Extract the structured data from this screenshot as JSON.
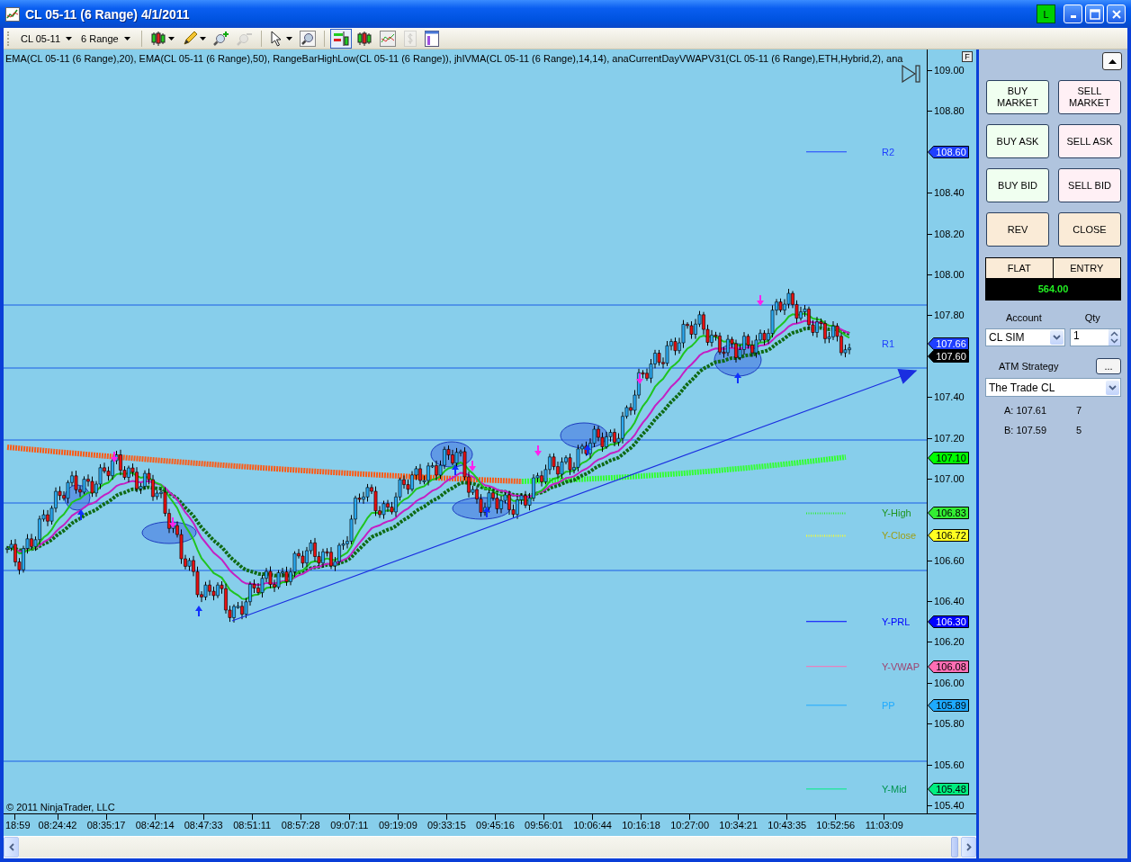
{
  "window": {
    "title": "CL 05-11 (6 Range)  4/1/2011",
    "badge": "L"
  },
  "toolbar": {
    "instrument": "CL 05-11",
    "period": "6 Range",
    "tool_groups": [
      [
        {
          "kind": "chart_style",
          "selected": false,
          "disabled": false
        },
        {
          "kind": "drawing",
          "selected": false,
          "disabled": false
        },
        {
          "kind": "zoom_in",
          "selected": false,
          "disabled": false
        },
        {
          "kind": "zoom_out",
          "selected": false,
          "disabled": true
        }
      ],
      [
        {
          "kind": "cursor",
          "selected": false,
          "disabled": false
        },
        {
          "kind": "magnifier",
          "selected": false,
          "disabled": false
        }
      ],
      [
        {
          "kind": "chart_trader",
          "selected": true,
          "disabled": false
        },
        {
          "kind": "data_series",
          "selected": false,
          "disabled": false
        },
        {
          "kind": "indicators",
          "selected": false,
          "disabled": false
        },
        {
          "kind": "strategies",
          "selected": false,
          "disabled": true
        },
        {
          "kind": "properties",
          "selected": false,
          "disabled": false
        }
      ]
    ]
  },
  "chart": {
    "legend": "EMA(CL 05-11 (6 Range),20), EMA(CL 05-11 (6 Range),50), RangeBarHighLow(CL 05-11 (6 Range)), jhIVMA(CL 05-11 (6 Range),14,14), anaCurrentDayVWAPV31(CL 05-11 (6 Range),ETH,Hybrid,2), ana",
    "corner_button": "F",
    "copyright": "© 2011 NinjaTrader, LLC",
    "price_ticks": [
      "109.00",
      "108.80",
      "108.40",
      "108.20",
      "108.00",
      "107.80",
      "107.40",
      "107.20",
      "107.00",
      "106.60",
      "106.40",
      "106.20",
      "106.00",
      "105.80",
      "105.60",
      "105.40"
    ],
    "time_labels": [
      "18:59",
      "08:24:42",
      "08:35:17",
      "08:42:14",
      "08:47:33",
      "08:51:11",
      "08:57:28",
      "09:07:11",
      "09:19:09",
      "09:33:15",
      "09:45:16",
      "09:56:01",
      "10:06:44",
      "10:16:18",
      "10:27:00",
      "10:34:21",
      "10:43:35",
      "10:52:56",
      "11:03:09"
    ],
    "levels": [
      {
        "label": "R2",
        "price": "108.60",
        "color": "#1f3fff",
        "segment": true
      },
      {
        "label": "R1",
        "price": "107.66",
        "color": "#1f3fff",
        "segment": false
      },
      {
        "label": "Y-High",
        "price": "106.83",
        "color": "#33ee33",
        "segment": true
      },
      {
        "label": "Y-Close",
        "price": "106.72",
        "color": "#ffff22",
        "segment": true
      },
      {
        "label": "Y-PRL",
        "price": "106.30",
        "color": "#0000ff",
        "segment": true
      },
      {
        "label": "Y-VWAP",
        "price": "106.08",
        "color": "#ff6eb4",
        "segment": true
      },
      {
        "label": "PP",
        "price": "105.89",
        "color": "#1eaaff",
        "segment": true
      },
      {
        "label": "Y-Mid",
        "price": "105.48",
        "color": "#00ee80",
        "segment": true
      }
    ],
    "extra_tags": [
      {
        "price": "107.60",
        "color": "#000000"
      },
      {
        "price": "107.10",
        "color": "#00ff00"
      }
    ]
  },
  "trader": {
    "buttons": [
      {
        "label": "BUY MARKET",
        "kind": "buy"
      },
      {
        "label": "SELL MARKET",
        "kind": "sell"
      },
      {
        "label": "BUY ASK",
        "kind": "buy"
      },
      {
        "label": "SELL ASK",
        "kind": "sell"
      },
      {
        "label": "BUY BID",
        "kind": "buy"
      },
      {
        "label": "SELL BID",
        "kind": "sell"
      },
      {
        "label": "REV",
        "kind": "neutral"
      },
      {
        "label": "CLOSE",
        "kind": "neutral"
      }
    ],
    "position": {
      "status": "FLAT",
      "entry": "ENTRY",
      "pnl": "564.00"
    },
    "account": {
      "label": "Account",
      "value": "CL SIM"
    },
    "qty": {
      "label": "Qty",
      "value": "1"
    },
    "atm": {
      "label": "ATM Strategy",
      "button": "...",
      "value": "The Trade CL"
    },
    "quotes": [
      {
        "label": "A: 107.61",
        "size": "7"
      },
      {
        "label": "B: 107.59",
        "size": "5"
      }
    ]
  }
}
